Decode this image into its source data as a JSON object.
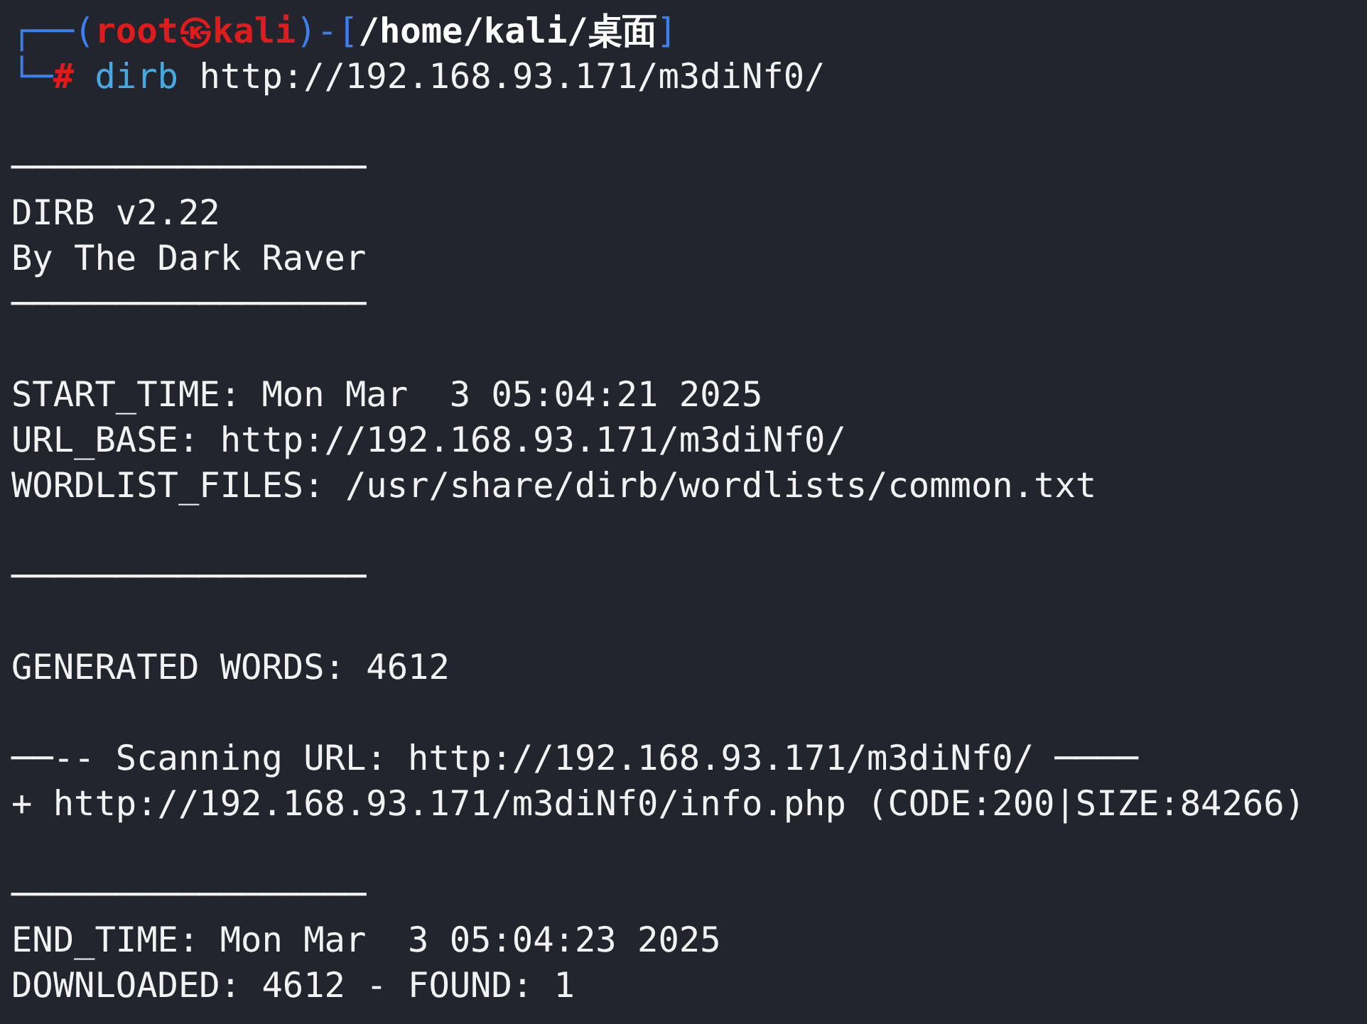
{
  "prompt": {
    "prefix": "┌──(",
    "user_host": "root㉿kali",
    "path_open": ")-[",
    "path": "/home/kali/桌面",
    "path_close": "]"
  },
  "command_line": {
    "prefix": "└─",
    "symbol": "#",
    "command": "dirb",
    "arguments": "http://192.168.93.171/m3diNf0/"
  },
  "output": [
    {
      "kind": "blank"
    },
    {
      "kind": "rule",
      "text": "─────────────────"
    },
    {
      "kind": "text",
      "text": "DIRB v2.22"
    },
    {
      "kind": "text",
      "text": "By The Dark Raver"
    },
    {
      "kind": "rule",
      "text": "─────────────────"
    },
    {
      "kind": "blank"
    },
    {
      "kind": "text",
      "text": "START_TIME: Mon Mar  3 05:04:21 2025"
    },
    {
      "kind": "text",
      "text": "URL_BASE: http://192.168.93.171/m3diNf0/"
    },
    {
      "kind": "text",
      "text": "WORDLIST_FILES: /usr/share/dirb/wordlists/common.txt"
    },
    {
      "kind": "blank"
    },
    {
      "kind": "rule",
      "text": "─────────────────"
    },
    {
      "kind": "blank"
    },
    {
      "kind": "text",
      "text": "GENERATED WORDS: 4612"
    },
    {
      "kind": "blank"
    },
    {
      "kind": "text",
      "text": "──-- Scanning URL: http://192.168.93.171/m3diNf0/ ────"
    },
    {
      "kind": "text",
      "text": "+ http://192.168.93.171/m3diNf0/info.php (CODE:200|SIZE:84266)"
    },
    {
      "kind": "blank"
    },
    {
      "kind": "rule",
      "text": "─────────────────"
    },
    {
      "kind": "text",
      "text": "END_TIME: Mon Mar  3 05:04:23 2025"
    },
    {
      "kind": "text",
      "text": "DOWNLOADED: 4612 - FOUND: 1"
    }
  ]
}
